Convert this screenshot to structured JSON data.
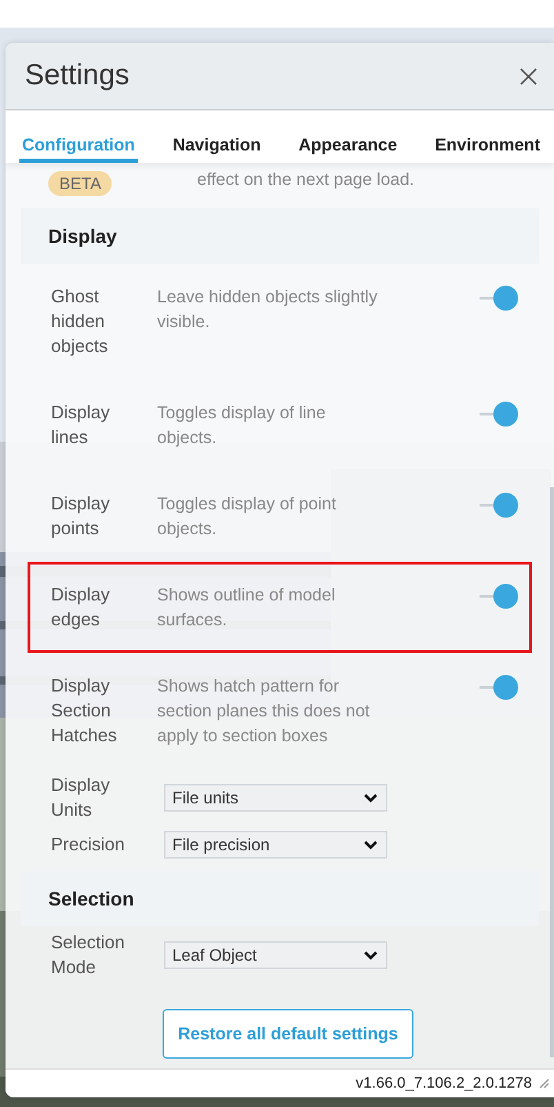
{
  "window": {
    "title": "Settings"
  },
  "tabs": [
    {
      "label": "Configuration",
      "selected": true
    },
    {
      "label": "Navigation",
      "selected": false
    },
    {
      "label": "Appearance",
      "selected": false
    },
    {
      "label": "Environment",
      "selected": false
    }
  ],
  "partial_row": {
    "badge": "BETA",
    "description": "effect on the next page load."
  },
  "sections": [
    {
      "title": "Display",
      "rows": [
        {
          "kind": "toggle",
          "label": "Ghost hidden objects",
          "description": "Leave hidden objects slightly visible.",
          "on": true,
          "highlighted": false
        },
        {
          "kind": "toggle",
          "label": "Display lines",
          "description": "Toggles display of line objects.",
          "on": true,
          "highlighted": false
        },
        {
          "kind": "toggle",
          "label": "Display points",
          "description": "Toggles display of point objects.",
          "on": true,
          "highlighted": false
        },
        {
          "kind": "toggle",
          "label": "Display edges",
          "description": "Shows outline of model surfaces.",
          "on": true,
          "highlighted": true
        },
        {
          "kind": "toggle",
          "label": "Display Section Hatches",
          "description": "Shows hatch pattern for section planes this does not apply to section boxes",
          "on": true,
          "highlighted": false
        },
        {
          "kind": "select",
          "label": "Display Units",
          "value": "File units"
        },
        {
          "kind": "select",
          "label": "Precision",
          "value": "File precision"
        }
      ]
    },
    {
      "title": "Selection",
      "rows": [
        {
          "kind": "select",
          "label": "Selection Mode",
          "value": "Leaf Object"
        }
      ]
    }
  ],
  "restore_button": "Restore all default settings",
  "version": "v1.66.0_7.106.2_2.0.1278"
}
